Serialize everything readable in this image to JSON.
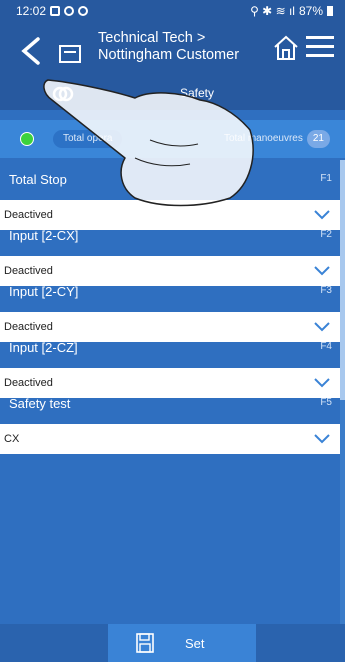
{
  "statusbar": {
    "time": "12:02",
    "battery": "87%"
  },
  "header": {
    "title_line1": "Technical Tech >",
    "title_line2": "Nottingham Customer"
  },
  "tabs": {
    "active_label": "Safety"
  },
  "counters": {
    "left_label": "Total opera",
    "right_label": "Total manoeuvres",
    "right_value": "21"
  },
  "fields": [
    {
      "label": "Total Stop",
      "key": "F1",
      "value": "Deactived"
    },
    {
      "label": "Input [2-CX]",
      "key": "F2",
      "value": "Deactived"
    },
    {
      "label": "Input [2-CY]",
      "key": "F3",
      "value": "Deactived"
    },
    {
      "label": "Input [2-CZ]",
      "key": "F4",
      "value": "Deactived"
    },
    {
      "label": "Safety test",
      "key": "F5",
      "value": "CX"
    }
  ],
  "bottom": {
    "set_label": "Set"
  },
  "icons": [
    "back-arrow-icon",
    "document-icon",
    "home-icon",
    "menu-icon",
    "link-icon",
    "chevron-down-icon",
    "floppy-disk-icon"
  ],
  "colors": {
    "header": "#27599f",
    "background": "#2f6fc0",
    "status_green": "#3cd23c"
  }
}
